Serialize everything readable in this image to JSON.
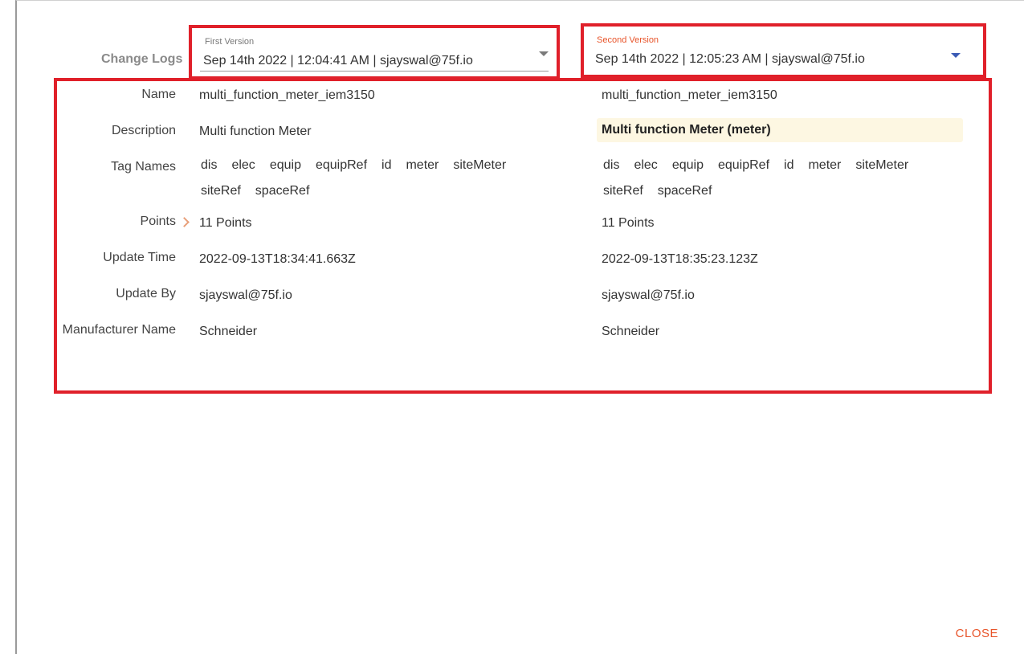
{
  "dialog": {
    "title": "Change Logs",
    "close_label": "CLOSE"
  },
  "first_version": {
    "caption": "First Version",
    "value": "Sep 14th 2022 | 12:04:41 AM | sjayswal@75f.io"
  },
  "second_version": {
    "caption": "Second Version",
    "value": "Sep 14th 2022 | 12:05:23 AM | sjayswal@75f.io"
  },
  "rows": {
    "name": {
      "label": "Name",
      "first": "multi_function_meter_iem3150",
      "second": "multi_function_meter_iem3150"
    },
    "description": {
      "label": "Description",
      "first": "Multi function Meter",
      "second": "Multi function Meter (meter)"
    },
    "tag_names": {
      "label": "Tag Names",
      "first": [
        "dis",
        "elec",
        "equip",
        "equipRef",
        "id",
        "meter",
        "siteMeter",
        "siteRef",
        "spaceRef"
      ],
      "second": [
        "dis",
        "elec",
        "equip",
        "equipRef",
        "id",
        "meter",
        "siteMeter",
        "siteRef",
        "spaceRef"
      ]
    },
    "points": {
      "label": "Points",
      "first": "11 Points",
      "second": "11 Points"
    },
    "update_time": {
      "label": "Update Time",
      "first": "2022-09-13T18:34:41.663Z",
      "second": "2022-09-13T18:35:23.123Z"
    },
    "update_by": {
      "label": "Update By",
      "first": "sjayswal@75f.io",
      "second": "sjayswal@75f.io"
    },
    "manufacturer_name": {
      "label": "Manufacturer Name",
      "first": "Schneider",
      "second": "Schneider"
    }
  },
  "colors": {
    "accent": "#e8542a",
    "annotation_border": "#e0202a",
    "highlight_bg": "#fdf7e2",
    "dropdown_arrow_active": "#3b5bb5"
  },
  "icons": {
    "dropdown": "caret-down-icon",
    "points_expand": "chevron-right-icon"
  }
}
